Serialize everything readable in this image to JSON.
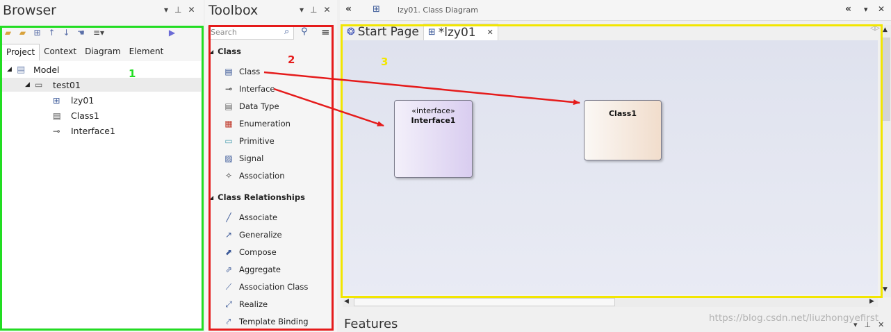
{
  "browser": {
    "title": "Browser",
    "tabs": [
      {
        "label": "Project",
        "active": true
      },
      {
        "label": "Context"
      },
      {
        "label": "Diagram"
      },
      {
        "label": "Element"
      }
    ],
    "tree": [
      {
        "label": "Model",
        "icon": "model-folder-icon"
      },
      {
        "label": "test01",
        "icon": "package-icon"
      },
      {
        "label": "lzy01",
        "icon": "class-diagram-icon"
      },
      {
        "label": "Class1",
        "icon": "class-icon"
      },
      {
        "label": "Interface1",
        "icon": "interface-icon"
      }
    ]
  },
  "toolbox": {
    "title": "Toolbox",
    "search_placeholder": "Search",
    "sections": [
      {
        "label": "Class",
        "items": [
          "Class",
          "Interface",
          "Data Type",
          "Enumeration",
          "Primitive",
          "Signal",
          "Association"
        ]
      },
      {
        "label": "Class Relationships",
        "items": [
          "Associate",
          "Generalize",
          "Compose",
          "Aggregate",
          "Association Class",
          "Realize",
          "Template Binding"
        ]
      }
    ]
  },
  "diagram": {
    "breadcrumb": "lzy01.  Class Diagram",
    "tabs": [
      {
        "label": "Start Page"
      },
      {
        "label": "*lzy01",
        "active": true
      }
    ],
    "nodes": {
      "interface": {
        "stereotype": "«interface»",
        "name": "Interface1"
      },
      "class": {
        "name": "Class1"
      }
    }
  },
  "features_title": "Features",
  "watermark": "https://blog.csdn.net/liuzhongyefirst",
  "annotations": {
    "n1": "1",
    "n2": "2",
    "n3": "3"
  },
  "colors": {
    "green": "#22dd22",
    "red": "#e51b1b",
    "yellow": "#f2e600",
    "arrow": "#e51b1b"
  }
}
